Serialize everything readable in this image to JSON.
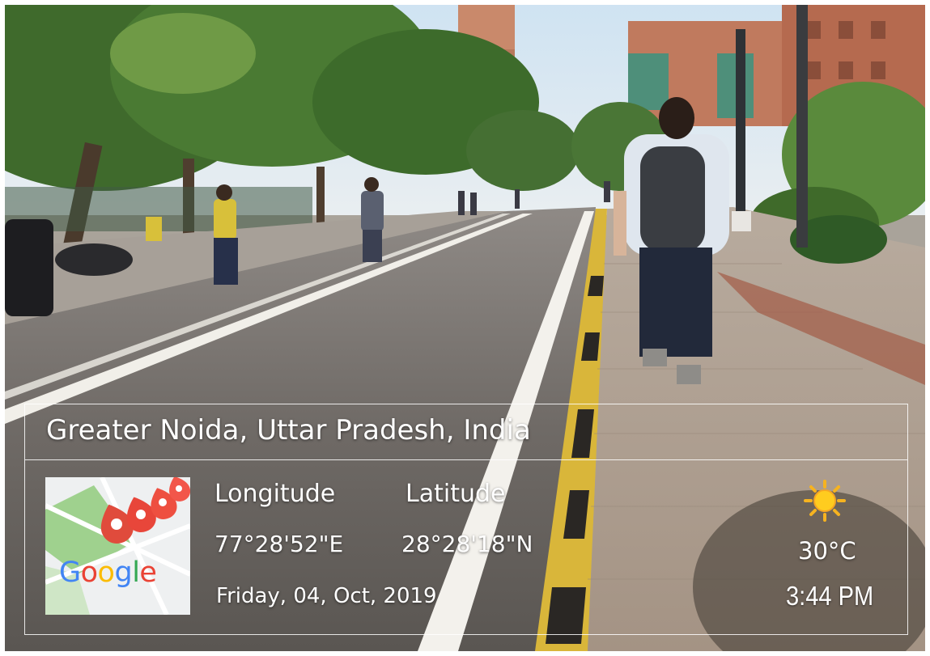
{
  "overlay": {
    "address": "Greater Noida, Uttar Pradesh, India",
    "longitude_label": "Longitude",
    "latitude_label": "Latitude",
    "longitude_value": "77°28'52\"E",
    "latitude_value": "28°28'18\"N",
    "date": "Friday, 04, Oct, 2019",
    "temperature": "30°C",
    "time": "3:44 PM",
    "map_logo": {
      "letters": [
        "G",
        "o",
        "o",
        "g",
        "l",
        "e"
      ],
      "colors": [
        "#4285F4",
        "#EA4335",
        "#FBBC05",
        "#4285F4",
        "#34A853",
        "#EA4335"
      ]
    },
    "weather_icon": "sun-icon",
    "map_icon": "map-pins-icon"
  },
  "scene": {
    "icons": [
      "street-photo"
    ]
  }
}
